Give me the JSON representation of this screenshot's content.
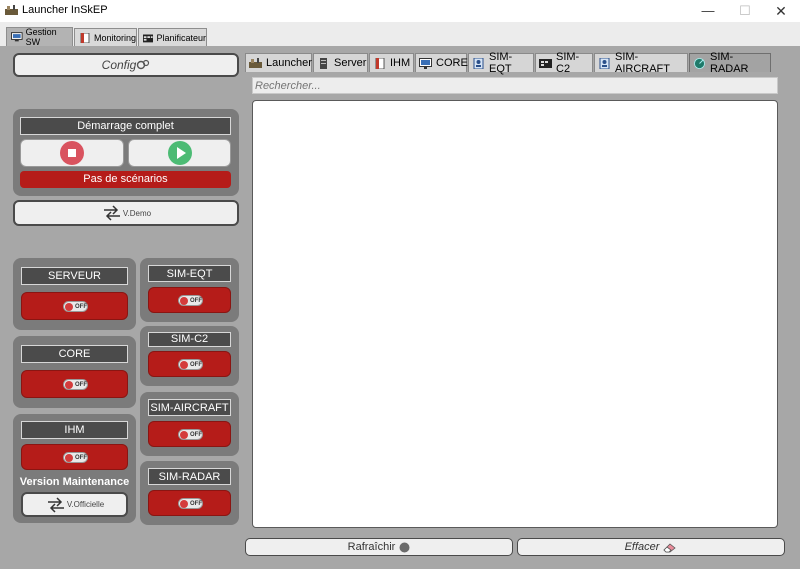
{
  "window": {
    "title": "Launcher InSkEP",
    "minimize": "—",
    "maximize": "☐",
    "close": "✕"
  },
  "top_tabs": [
    {
      "label": "Gestion SW",
      "icon": "monitor-icon",
      "active": true
    },
    {
      "label": "Monitoring",
      "icon": "document-icon",
      "active": false
    },
    {
      "label": "Planificateur",
      "icon": "calendar-icon",
      "active": false
    }
  ],
  "left": {
    "config_label": "Config",
    "demarrage": {
      "title": "Démarrage complet",
      "status": "Pas de scénarios"
    },
    "demo_label": "V.Demo",
    "toggle_text": "OFF",
    "modules": {
      "serveur": "SERVEUR",
      "core": "CORE",
      "ihm": "IHM",
      "sim_eqt": "SIM-EQT",
      "sim_c2": "SIM-C2",
      "sim_aircraft": "SIM-AIRCRAFT",
      "sim_radar": "SIM-RADAR"
    },
    "version_label": "Version Maintenance",
    "officielle_label": "V.Officielle"
  },
  "right": {
    "tabs": [
      {
        "label": "Launcher",
        "icon": "launcher-icon"
      },
      {
        "label": "Server",
        "icon": "server-icon"
      },
      {
        "label": "IHM",
        "icon": "document-icon"
      },
      {
        "label": "CORE",
        "icon": "monitor-icon"
      },
      {
        "label": "SIM-EQT",
        "icon": "network-icon"
      },
      {
        "label": "SIM-C2",
        "icon": "console-icon"
      },
      {
        "label": "SIM-AIRCRAFT",
        "icon": "network-icon"
      },
      {
        "label": "SIM-RADAR",
        "icon": "radar-icon",
        "active": true
      }
    ],
    "search_placeholder": "Rechercher...",
    "refresh_label": "Rafraîchir",
    "clear_label": "Effacer"
  },
  "colors": {
    "toggle_red": "#b51c19",
    "group_gray": "#7b7b7b",
    "stop_red": "#d9535f",
    "play_green": "#4cbb74"
  }
}
